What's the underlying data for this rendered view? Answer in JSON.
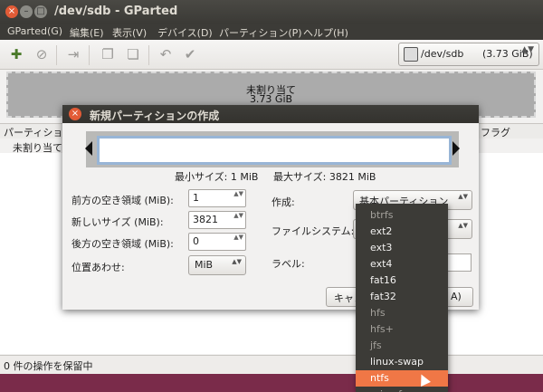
{
  "window": {
    "title": "/dev/sdb - GParted",
    "close_glyph": "×",
    "min_glyph": "–",
    "max_glyph": "□"
  },
  "menubar": {
    "items": [
      "GParted(G)",
      "編集(E)",
      "表示(V)",
      "デバイス(D)",
      "パーティション(P)",
      "ヘルプ(H)"
    ]
  },
  "toolbar": {
    "icons": [
      "new-partition-icon",
      "delete-icon",
      "resize-icon",
      "copy-icon",
      "paste-icon",
      "undo-icon",
      "apply-icon"
    ],
    "glyphs": [
      "✚",
      "⊘",
      "⇥",
      "❐",
      "❏",
      "↶",
      "✔"
    ]
  },
  "device": {
    "name": "/dev/sdb",
    "size": "(3.73 GiB)",
    "arrow": "▲▼"
  },
  "disk_map": {
    "label": "未割り当て",
    "size": "3.73 GiB"
  },
  "partition_list": {
    "headers": [
      "パーティション",
      "フラグ"
    ],
    "row": "未割り当て"
  },
  "statusbar": {
    "text": "0 件の操作を保留中"
  },
  "dialog": {
    "title": "新規パーティションの作成",
    "close_glyph": "×",
    "min_size": "最小サイズ: 1 MiB",
    "max_size": "最大サイズ: 3821 MiB",
    "fields": {
      "free_before_label": "前方の空き領域 (MiB):",
      "free_before": "1",
      "new_size_label": "新しいサイズ (MiB):",
      "new_size": "3821",
      "free_after_label": "後方の空き領域 (MiB):",
      "free_after": "0",
      "align_label": "位置あわせ:",
      "align": "MiB",
      "create_as_label": "作成:",
      "create_as": "基本パーティション",
      "filesystem_label": "ファイルシステム:",
      "label_label": "ラベル:"
    },
    "cancel_button": "キャン",
    "add_button": "A)",
    "spin_arrows": "▲▼",
    "combo_arrows": "▲▼"
  },
  "dropdown": {
    "items": [
      {
        "label": "btrfs",
        "enabled": false
      },
      {
        "label": "ext2",
        "enabled": true
      },
      {
        "label": "ext3",
        "enabled": true
      },
      {
        "label": "ext4",
        "enabled": true
      },
      {
        "label": "fat16",
        "enabled": true
      },
      {
        "label": "fat32",
        "enabled": true
      },
      {
        "label": "hfs",
        "enabled": false
      },
      {
        "label": "hfs+",
        "enabled": false
      },
      {
        "label": "jfs",
        "enabled": false
      },
      {
        "label": "linux-swap",
        "enabled": true
      },
      {
        "label": "ntfs",
        "enabled": true,
        "selected": true
      },
      {
        "label": "reiserfs",
        "enabled": false
      }
    ]
  }
}
